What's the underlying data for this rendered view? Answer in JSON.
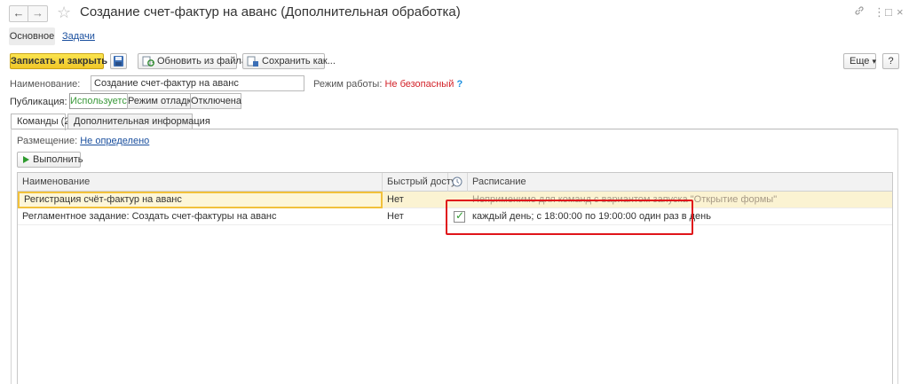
{
  "window": {
    "title": "Создание счет-фактур на аванс (Дополнительная обработка)",
    "back_label": "←",
    "forward_label": "→",
    "star_label": "☆",
    "link_label": "🔗",
    "menu_label": "⋮",
    "maximize_label": "□",
    "close_label": "×"
  },
  "tabs": [
    {
      "label": "Основное"
    },
    {
      "label": "Задачи"
    }
  ],
  "toolbar": {
    "write_close_label": "Записать и закрыть",
    "update_label": "Обновить из файла...",
    "save_as_label": "Сохранить как...",
    "more_label": "Еще",
    "more_arrow": "▾",
    "help_label": "?"
  },
  "form": {
    "name_label": "Наименование:",
    "name_value": "Создание счет-фактур на аванс",
    "mode_label": "Режим работы:",
    "mode_value": "Не безопасный",
    "mode_help": "?",
    "publication_label": "Публикация:",
    "publication_options": [
      "Используется",
      "Режим отладки",
      "Отключена"
    ]
  },
  "subtabs": [
    {
      "label": "Команды (2)"
    },
    {
      "label": "Дополнительная информация"
    }
  ],
  "commands": {
    "placement_label": "Размещение:",
    "placement_value": "Не определено",
    "execute_label": "Выполнить",
    "columns": [
      "Наименование",
      "Быстрый доступ",
      "",
      "Расписание"
    ],
    "rows": [
      {
        "name": "Регистрация счёт-фактур на аванс",
        "quick_access": "Нет",
        "schedule": "Неприменимо для команд с вариантом запуска \"Открытие формы\""
      },
      {
        "name": "Регламентное задание: Создать счет-фактуры на аванс",
        "quick_access": "Нет",
        "checked": "✓",
        "schedule": "каждый день; с 18:00:00 по 19:00:00 один раз в день"
      }
    ]
  },
  "colors": {
    "accent_yellow": "#f0c728",
    "link_blue": "#1a4f9e",
    "warning_red": "#d3232a",
    "highlight_red": "#e0151a",
    "active_green": "#3a9a3a",
    "check_green": "#2e9a2e"
  },
  "icons": {
    "save": "floppy-disk-icon",
    "update": "refresh-file-icon",
    "save_as": "save-as-icon",
    "execute": "play-icon",
    "clock": "clock-icon"
  }
}
